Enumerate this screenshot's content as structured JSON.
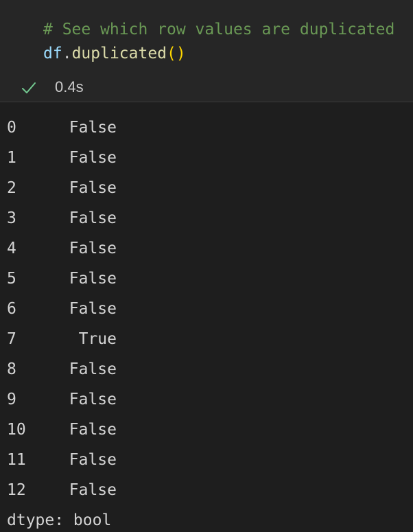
{
  "code_cell": {
    "comment": "# See which row values are duplicated",
    "code_var": "df",
    "code_dot": ".",
    "code_func": "duplicated",
    "code_parens": "()"
  },
  "status": {
    "icon": "check-icon",
    "exec_time": "0.4s",
    "success_color": "#73c991"
  },
  "output": {
    "rows": [
      {
        "index": "0",
        "value": "False"
      },
      {
        "index": "1",
        "value": "False"
      },
      {
        "index": "2",
        "value": "False"
      },
      {
        "index": "3",
        "value": "False"
      },
      {
        "index": "4",
        "value": "False"
      },
      {
        "index": "5",
        "value": "False"
      },
      {
        "index": "6",
        "value": "False"
      },
      {
        "index": "7",
        "value": "True"
      },
      {
        "index": "8",
        "value": "False"
      },
      {
        "index": "9",
        "value": "False"
      },
      {
        "index": "10",
        "value": "False"
      },
      {
        "index": "11",
        "value": "False"
      },
      {
        "index": "12",
        "value": "False"
      }
    ],
    "dtype": "dtype: bool"
  }
}
